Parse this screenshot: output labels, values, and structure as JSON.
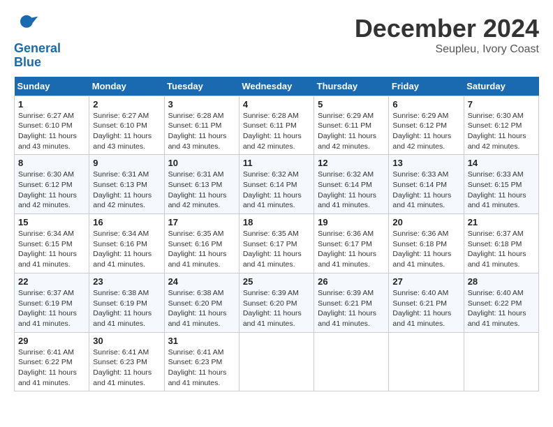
{
  "header": {
    "logo_line1": "General",
    "logo_line2": "Blue",
    "month": "December 2024",
    "location": "Seupleu, Ivory Coast"
  },
  "days_of_week": [
    "Sunday",
    "Monday",
    "Tuesday",
    "Wednesday",
    "Thursday",
    "Friday",
    "Saturday"
  ],
  "weeks": [
    [
      {
        "day": 1,
        "sunrise": "6:27 AM",
        "sunset": "6:10 PM",
        "daylight": "11 hours and 43 minutes."
      },
      {
        "day": 2,
        "sunrise": "6:27 AM",
        "sunset": "6:10 PM",
        "daylight": "11 hours and 43 minutes."
      },
      {
        "day": 3,
        "sunrise": "6:28 AM",
        "sunset": "6:11 PM",
        "daylight": "11 hours and 43 minutes."
      },
      {
        "day": 4,
        "sunrise": "6:28 AM",
        "sunset": "6:11 PM",
        "daylight": "11 hours and 42 minutes."
      },
      {
        "day": 5,
        "sunrise": "6:29 AM",
        "sunset": "6:11 PM",
        "daylight": "11 hours and 42 minutes."
      },
      {
        "day": 6,
        "sunrise": "6:29 AM",
        "sunset": "6:12 PM",
        "daylight": "11 hours and 42 minutes."
      },
      {
        "day": 7,
        "sunrise": "6:30 AM",
        "sunset": "6:12 PM",
        "daylight": "11 hours and 42 minutes."
      }
    ],
    [
      {
        "day": 8,
        "sunrise": "6:30 AM",
        "sunset": "6:12 PM",
        "daylight": "11 hours and 42 minutes."
      },
      {
        "day": 9,
        "sunrise": "6:31 AM",
        "sunset": "6:13 PM",
        "daylight": "11 hours and 42 minutes."
      },
      {
        "day": 10,
        "sunrise": "6:31 AM",
        "sunset": "6:13 PM",
        "daylight": "11 hours and 42 minutes."
      },
      {
        "day": 11,
        "sunrise": "6:32 AM",
        "sunset": "6:14 PM",
        "daylight": "11 hours and 41 minutes."
      },
      {
        "day": 12,
        "sunrise": "6:32 AM",
        "sunset": "6:14 PM",
        "daylight": "11 hours and 41 minutes."
      },
      {
        "day": 13,
        "sunrise": "6:33 AM",
        "sunset": "6:14 PM",
        "daylight": "11 hours and 41 minutes."
      },
      {
        "day": 14,
        "sunrise": "6:33 AM",
        "sunset": "6:15 PM",
        "daylight": "11 hours and 41 minutes."
      }
    ],
    [
      {
        "day": 15,
        "sunrise": "6:34 AM",
        "sunset": "6:15 PM",
        "daylight": "11 hours and 41 minutes."
      },
      {
        "day": 16,
        "sunrise": "6:34 AM",
        "sunset": "6:16 PM",
        "daylight": "11 hours and 41 minutes."
      },
      {
        "day": 17,
        "sunrise": "6:35 AM",
        "sunset": "6:16 PM",
        "daylight": "11 hours and 41 minutes."
      },
      {
        "day": 18,
        "sunrise": "6:35 AM",
        "sunset": "6:17 PM",
        "daylight": "11 hours and 41 minutes."
      },
      {
        "day": 19,
        "sunrise": "6:36 AM",
        "sunset": "6:17 PM",
        "daylight": "11 hours and 41 minutes."
      },
      {
        "day": 20,
        "sunrise": "6:36 AM",
        "sunset": "6:18 PM",
        "daylight": "11 hours and 41 minutes."
      },
      {
        "day": 21,
        "sunrise": "6:37 AM",
        "sunset": "6:18 PM",
        "daylight": "11 hours and 41 minutes."
      }
    ],
    [
      {
        "day": 22,
        "sunrise": "6:37 AM",
        "sunset": "6:19 PM",
        "daylight": "11 hours and 41 minutes."
      },
      {
        "day": 23,
        "sunrise": "6:38 AM",
        "sunset": "6:19 PM",
        "daylight": "11 hours and 41 minutes."
      },
      {
        "day": 24,
        "sunrise": "6:38 AM",
        "sunset": "6:20 PM",
        "daylight": "11 hours and 41 minutes."
      },
      {
        "day": 25,
        "sunrise": "6:39 AM",
        "sunset": "6:20 PM",
        "daylight": "11 hours and 41 minutes."
      },
      {
        "day": 26,
        "sunrise": "6:39 AM",
        "sunset": "6:21 PM",
        "daylight": "11 hours and 41 minutes."
      },
      {
        "day": 27,
        "sunrise": "6:40 AM",
        "sunset": "6:21 PM",
        "daylight": "11 hours and 41 minutes."
      },
      {
        "day": 28,
        "sunrise": "6:40 AM",
        "sunset": "6:22 PM",
        "daylight": "11 hours and 41 minutes."
      }
    ],
    [
      {
        "day": 29,
        "sunrise": "6:41 AM",
        "sunset": "6:22 PM",
        "daylight": "11 hours and 41 minutes."
      },
      {
        "day": 30,
        "sunrise": "6:41 AM",
        "sunset": "6:23 PM",
        "daylight": "11 hours and 41 minutes."
      },
      {
        "day": 31,
        "sunrise": "6:41 AM",
        "sunset": "6:23 PM",
        "daylight": "11 hours and 41 minutes."
      },
      null,
      null,
      null,
      null
    ]
  ]
}
